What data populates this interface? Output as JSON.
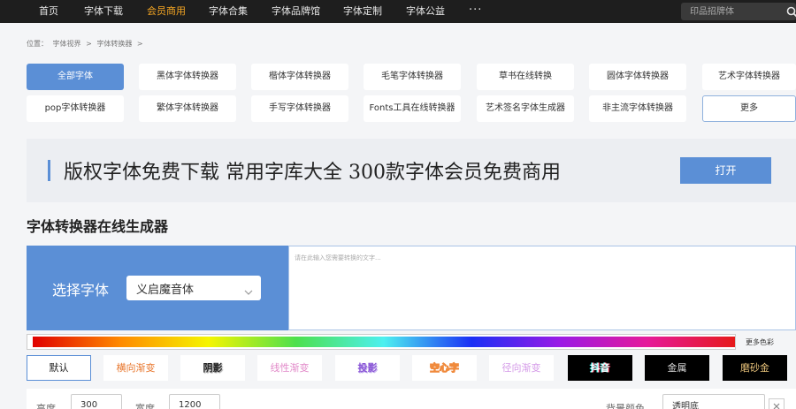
{
  "nav": {
    "items": [
      "首页",
      "字体下载",
      "会员商用",
      "字体合集",
      "字体品牌馆",
      "字体定制",
      "字体公益"
    ],
    "more": "···",
    "search_placeholder": "印品招牌体"
  },
  "breadcrumb": [
    "位置：",
    "字体视界",
    ">",
    "字体转换器",
    ">"
  ],
  "categories": {
    "row1": [
      "全部字体",
      "黑体字体转换器",
      "楷体字体转换器",
      "毛笔字体转换器",
      "草书在线转换",
      "圆体字体转换器",
      "艺术字体转换器"
    ],
    "row2": [
      "pop字体转换器",
      "繁体字体转换器",
      "手写字体转换器",
      "Fonts工具在线转换器",
      "艺术签名字体生成器",
      "非主流字体转换器",
      "更多"
    ]
  },
  "banner": {
    "text": "版权字体免费下载  常用字库大全   300款字体会员免费商用",
    "button": "打开"
  },
  "section_title": "字体转换器在线生成器",
  "generator": {
    "select_label": "选择字体",
    "selected_font": "义启魔音体",
    "input_placeholder": "请在此输入您需要转换的文字..."
  },
  "more_colors": "更多色彩",
  "styles": [
    "默认",
    "横向渐变",
    "阴影",
    "线性渐变",
    "投影",
    "空心字",
    "径向渐变",
    "抖音",
    "金属",
    "磨砂金"
  ],
  "style_colors": {
    "横向渐变": "#e8772e",
    "阴影": "#222222",
    "线性渐变": "#e28ac9",
    "投影": "#8a56d6",
    "空心字": "#f08a3c",
    "径向渐变": "#d59be8",
    "抖音": "#ffffff",
    "金属": "#dcdcdc",
    "磨砂金": "#e8c27a"
  },
  "form": {
    "height_label": "高度",
    "height_value": "300",
    "width_label": "宽度",
    "width_value": "1200",
    "bg_label": "背景颜色",
    "bg_value": "透明底"
  },
  "colors": {
    "accent": "#5b8fd6",
    "nav_bg": "#1e1e1e",
    "nav_active": "#f5a623"
  }
}
